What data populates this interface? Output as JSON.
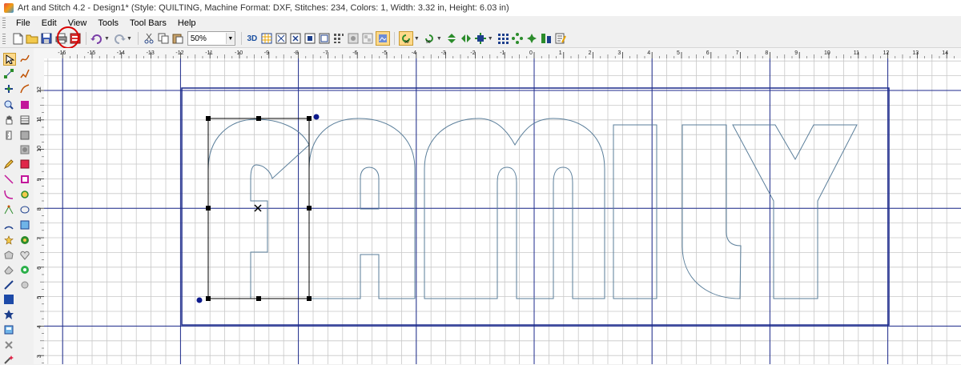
{
  "window": {
    "title": "Art and Stitch 4.2 - Design1* (Style: QUILTING, Machine Format: DXF, Stitches: 234, Colors: 1, Width: 3.32 in, Height: 6.03 in)"
  },
  "menu": {
    "items": [
      {
        "label": "File"
      },
      {
        "label": "Edit"
      },
      {
        "label": "View"
      },
      {
        "label": "Tools"
      },
      {
        "label": "Tool Bars"
      },
      {
        "label": "Help"
      }
    ]
  },
  "toolbar": {
    "zoom_value": "50%",
    "button_3d": "3D"
  },
  "rulers": {
    "top_labels": [
      "-16",
      "-15",
      "-14",
      "-13",
      "-12",
      "-11",
      "-10",
      "-9",
      "-8",
      "-7",
      "-6",
      "-5",
      "-4",
      "-3",
      "-2",
      "-1",
      "0",
      "1",
      "2",
      "3",
      "4",
      "5",
      "6",
      "7",
      "8",
      "9",
      "10",
      "11",
      "12",
      "13",
      "14"
    ],
    "left_labels": [
      "12",
      "11",
      "10",
      "9",
      "8",
      "7",
      "6",
      "5",
      "4",
      "3"
    ]
  },
  "canvas": {
    "letters": [
      "F",
      "A",
      "M",
      "I",
      "L",
      "Y"
    ]
  },
  "colors": {
    "major_grid": "#1c2a8c",
    "minor_grid": "#c8c8c8",
    "outline": "#5a7e9a",
    "selection": "#000000",
    "handle_point": "#0d1a8c",
    "highlight": "#d90000"
  }
}
